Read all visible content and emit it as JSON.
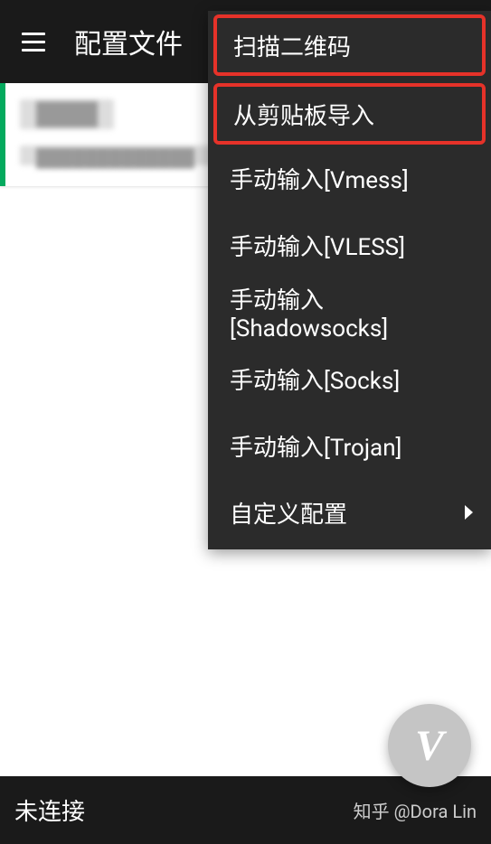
{
  "app_bar": {
    "title": "配置文件"
  },
  "profile": {
    "title_placeholder": "████",
    "subtitle_placeholder": "█████████████"
  },
  "menu": {
    "items": [
      {
        "label": "扫描二维码",
        "highlighted": true,
        "has_arrow": false
      },
      {
        "label": "从剪贴板导入",
        "highlighted": true,
        "has_arrow": false
      },
      {
        "label": "手动输入[Vmess]",
        "highlighted": false,
        "has_arrow": false
      },
      {
        "label": "手动输入[VLESS]",
        "highlighted": false,
        "has_arrow": false
      },
      {
        "label": "手动输入[Shadowsocks]",
        "highlighted": false,
        "has_arrow": false
      },
      {
        "label": "手动输入[Socks]",
        "highlighted": false,
        "has_arrow": false
      },
      {
        "label": "手动输入[Trojan]",
        "highlighted": false,
        "has_arrow": false
      },
      {
        "label": "自定义配置",
        "highlighted": false,
        "has_arrow": true
      }
    ]
  },
  "fab": {
    "icon_text": "V"
  },
  "bottom": {
    "status": "未连接",
    "watermark": "知乎 @Dora Lin"
  }
}
